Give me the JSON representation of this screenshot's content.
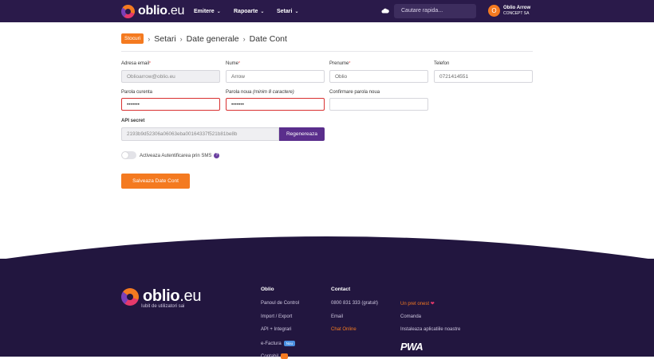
{
  "header": {
    "logo_main": "oblio",
    "logo_tld": ".eu",
    "nav": [
      {
        "label": "Emitere"
      },
      {
        "label": "Rapoarte"
      },
      {
        "label": "Setari"
      }
    ],
    "search_placeholder": "Cautare rapida...",
    "user_initial": "O",
    "user_name": "Oblio Arrow",
    "user_company": "CONCEPT SA"
  },
  "breadcrumb": {
    "badge": "Stocuri",
    "items": [
      "Setari",
      "Date generale",
      "Date Cont"
    ]
  },
  "form": {
    "email": {
      "label": "Adresa email",
      "value": "Oblioarrow@oblio.eu"
    },
    "nume": {
      "label": "Nume",
      "value": "Arrow"
    },
    "prenume": {
      "label": "Prenume",
      "value": "Oblio"
    },
    "telefon": {
      "label": "Telefon",
      "value": "0721414551"
    },
    "parola_curenta": {
      "label": "Parola curenta",
      "value": "•••••••"
    },
    "parola_noua": {
      "label": "Parola noua",
      "hint": "(minim 8 caractere)",
      "value": "•••••••"
    },
    "confirmare": {
      "label": "Confirmare parola noua",
      "value": ""
    },
    "api": {
      "label": "API secret",
      "value": "2193b9d52306a06063eba00164337f521b81be8b",
      "button": "Regenereaza"
    },
    "sms_toggle": {
      "label": "Activeaza Autentificarea prin SMS",
      "on": false
    },
    "save_button": "Salveaza Date Cont"
  },
  "footer": {
    "logo_main": "oblio",
    "logo_tld": ".eu",
    "tagline": "Iubit de utilizatori sai",
    "col1": {
      "title": "Oblio",
      "links": [
        "Panoul de Control",
        "Import / Export",
        "API + Integrari",
        "e-Factura"
      ],
      "pill": "Nou",
      "partial": "Contabil"
    },
    "col2": {
      "title": "Contact",
      "links": [
        "0800 831 333 (gratuit)",
        "Email",
        "Chat Online"
      ]
    },
    "col3": {
      "links": [
        "Un pret onest",
        "Comanda",
        "Instaleaza aplicatiile noastre"
      ],
      "pwa": "PWA"
    }
  },
  "colors": {
    "header_bg": "#2a1a4a",
    "accent": "#f47a20",
    "purple_button": "#5a2e8c",
    "footer_bg": "#22163f",
    "error_border": "#d93030"
  }
}
